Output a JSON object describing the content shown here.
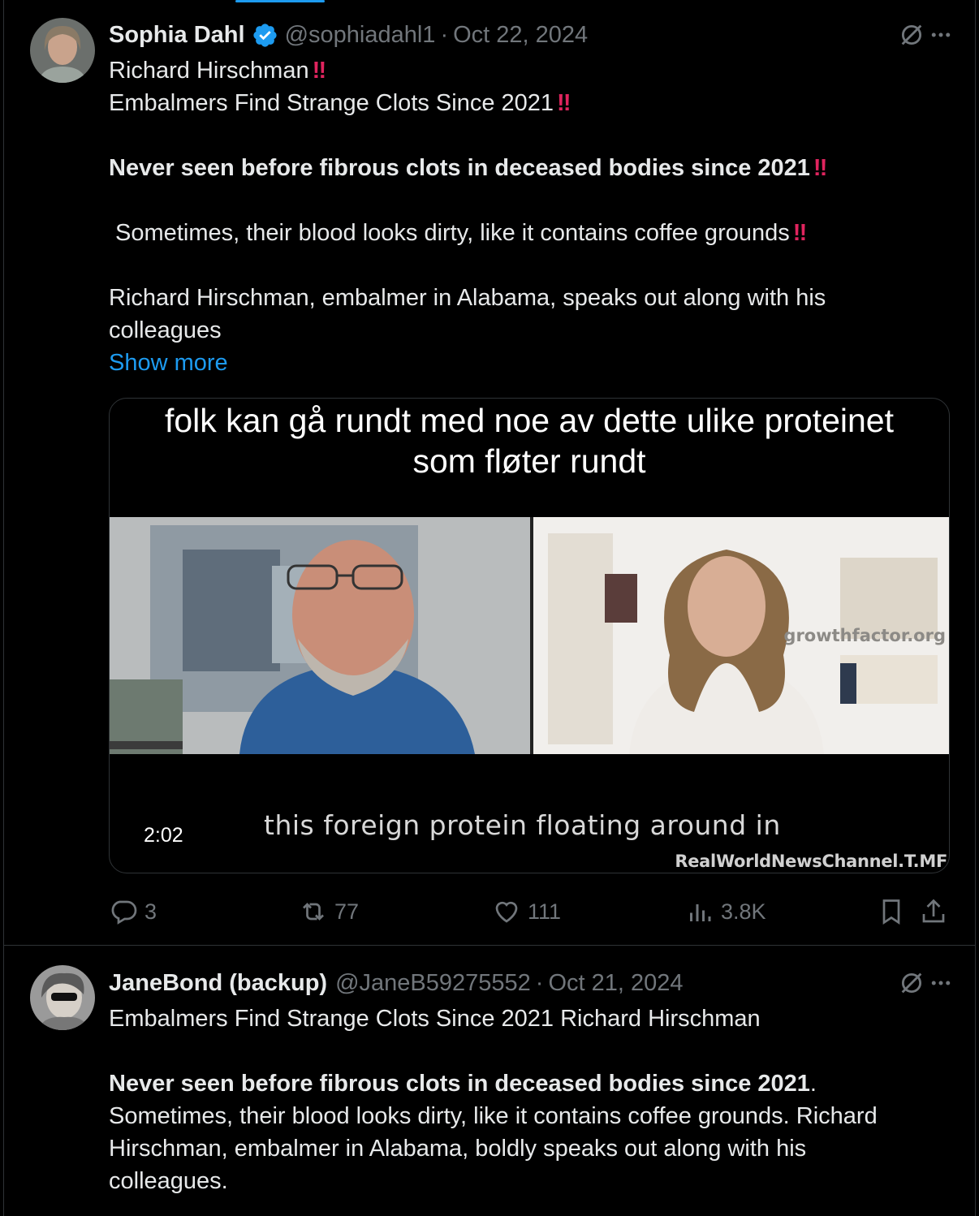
{
  "tweets": [
    {
      "display_name": "Sophia Dahl",
      "handle": "@sophiadahl1",
      "separator": "·",
      "date": "Oct 22, 2024",
      "verified": true,
      "lines": [
        {
          "text": "Richard Hirschman",
          "bang": "‼"
        },
        {
          "text": "Embalmers Find Strange Clots Since 2021",
          "bang": "‼"
        },
        {
          "text": ""
        },
        {
          "text": "Never seen before fibrous clots in deceased bodies since 2021",
          "bang": "‼",
          "bold": true
        },
        {
          "text": ""
        },
        {
          "text": " Sometimes, their blood looks dirty, like it contains coffee grounds",
          "bang": "‼"
        },
        {
          "text": ""
        },
        {
          "text": "Richard Hirschman, embalmer in Alabama, speaks out along with his"
        },
        {
          "text": "colleagues"
        }
      ],
      "show_more": "Show more",
      "media": {
        "caption_top_line1": "folk kan gå rundt med noe av dette ulike proteinet",
        "caption_top_line2": "som fløter rundt",
        "caption_bottom": "this foreign protein floating around in",
        "watermark_site": "growthfactor.org",
        "watermark_channel": "RealWorldNewsChannel.T.MF",
        "duration": "2:02"
      },
      "stats": {
        "replies": "3",
        "reposts": "77",
        "likes": "111",
        "views": "3.8K"
      }
    },
    {
      "display_name": "JaneBond (backup)",
      "handle": "@JaneB59275552",
      "separator": "·",
      "date": "Oct 21, 2024",
      "line1": "Embalmers Find Strange Clots Since 2021 Richard Hirschman",
      "bold_text": "Never seen before fibrous clots in deceased bodies since 2021",
      "after_bold": ".",
      "line3": "Sometimes, their blood looks dirty, like it contains coffee grounds. Richard",
      "line4": "Hirschman, embalmer in Alabama, boldly speaks out along with his",
      "line5": "colleagues."
    }
  ],
  "colors": {
    "background": "#000000",
    "text": "#e7e9ea",
    "muted": "#71767b",
    "link": "#1d9bf0",
    "bang": "#e0245e",
    "border": "#2f3336"
  },
  "icons": [
    "verified-icon",
    "grok-icon",
    "more-icon",
    "reply-icon",
    "repost-icon",
    "like-icon",
    "views-icon",
    "bookmark-icon",
    "share-icon"
  ]
}
